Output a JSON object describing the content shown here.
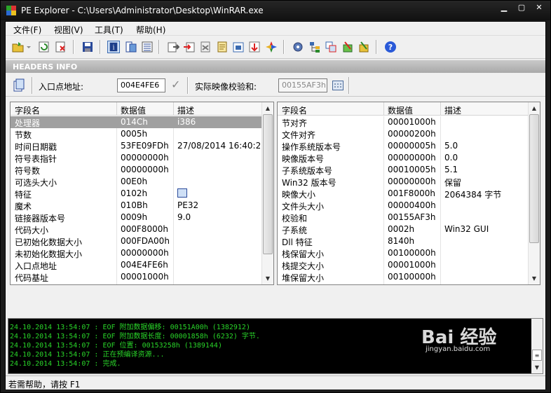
{
  "window": {
    "title": "PE Explorer - C:\\Users\\Administrator\\Desktop\\WinRAR.exe",
    "minimize": "▁",
    "maximize": "▢",
    "close": "✕"
  },
  "menu": [
    "文件(F)",
    "视图(V)",
    "工具(T)",
    "帮助(H)"
  ],
  "toolbar_icons": [
    "open-icon",
    "dropdown-icon",
    "refresh-icon",
    "close-file-icon",
    "save-icon",
    "headers-info-icon",
    "data-directories-icon",
    "section-headers-icon",
    "exports-icon",
    "imports-icon",
    "resources-icon",
    "debug-icon",
    "dependency-icon",
    "relocations-icon",
    "disassembler-icon",
    "settings-icon",
    "tree-icon",
    "compare-icon",
    "plugin-icon",
    "plugin2-icon",
    "help-icon"
  ],
  "section_title": "HEADERS INFO",
  "entry": {
    "entry_label": "入口点地址:",
    "entry_value": "004E4FE6",
    "checksum_label": "实际映像校验和:",
    "checksum_value": "00155AF3h"
  },
  "left_table": {
    "columns": [
      "字段名",
      "数据值",
      "描述"
    ],
    "rows": [
      [
        "处理器",
        "014Ch",
        "i386"
      ],
      [
        "节数",
        "0005h",
        ""
      ],
      [
        "时间日期戳",
        "53FE09FDh",
        "27/08/2014  16:40:29"
      ],
      [
        "符号表指针",
        "00000000h",
        ""
      ],
      [
        "符号数",
        "00000000h",
        ""
      ],
      [
        "可选头大小",
        "00E0h",
        ""
      ],
      [
        "特征",
        "0102h",
        ""
      ],
      [
        "魔术",
        "010Bh",
        "PE32"
      ],
      [
        "链接器版本号",
        "0009h",
        "9.0"
      ],
      [
        "代码大小",
        "000F8000h",
        ""
      ],
      [
        "已初始化数据大小",
        "000FDA00h",
        ""
      ],
      [
        "未初始化数据大小",
        "00000000h",
        ""
      ],
      [
        "入口点地址",
        "004E4FE6h",
        ""
      ],
      [
        "代码基址",
        "00001000h",
        ""
      ]
    ]
  },
  "right_table": {
    "columns": [
      "字段名",
      "数据值",
      "描述"
    ],
    "rows": [
      [
        "节对齐",
        "00001000h",
        ""
      ],
      [
        "文件对齐",
        "00000200h",
        ""
      ],
      [
        "操作系统版本号",
        "00000005h",
        "5.0"
      ],
      [
        "映像版本号",
        "00000000h",
        "0.0"
      ],
      [
        "子系统版本号",
        "00010005h",
        "5.1"
      ],
      [
        "Win32 版本号",
        "00000000h",
        "保留"
      ],
      [
        "映像大小",
        "001F8000h",
        "2064384 字节"
      ],
      [
        "文件头大小",
        "00000400h",
        ""
      ],
      [
        "校验和",
        "00155AF3h",
        ""
      ],
      [
        "子系统",
        "0002h",
        "Win32 GUI"
      ],
      [
        "Dll 特征",
        "8140h",
        ""
      ],
      [
        "栈保留大小",
        "00100000h",
        ""
      ],
      [
        "栈提交大小",
        "00001000h",
        ""
      ],
      [
        "堆保留大小",
        "00100000h",
        ""
      ]
    ]
  },
  "log": [
    "24.10.2014 13:54:07 : EOF 附加数据偏移: 00151A00h  (1382912)",
    "24.10.2014 13:54:07 : EOF 附加数据长度: 00001858h  (6232) 字节.",
    "24.10.2014 13:54:07 : EOF 位置: 00153258h  (1389144)",
    "24.10.2014 13:54:07 : 正在预编译资源...",
    "24.10.2014 13:54:07 : 完成."
  ],
  "status": "若需帮助，请按 F1",
  "watermark": {
    "main": "Bai 经验",
    "sub": "jingyan.baidu.com"
  }
}
